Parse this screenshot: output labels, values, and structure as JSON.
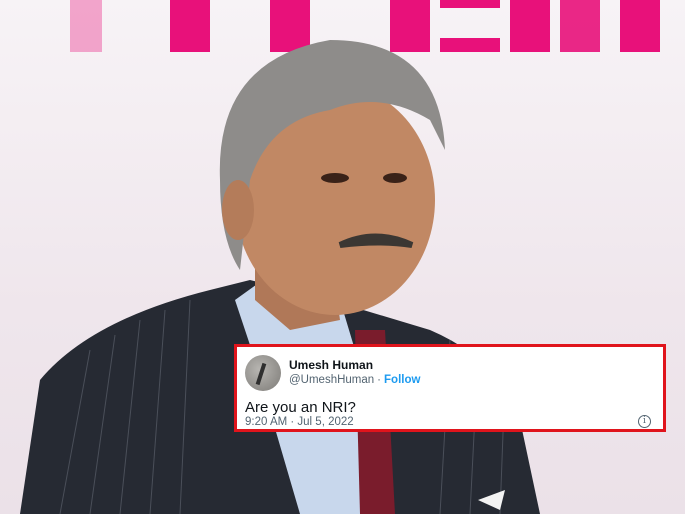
{
  "tweet": {
    "display_name": "Umesh Human",
    "handle": "@UmeshHuman",
    "separator": "·",
    "follow_label": "Follow",
    "text": "Are you an NRI?",
    "timestamp": "9:20 AM · Jul 5, 2022",
    "info_glyph": "i"
  },
  "colors": {
    "highlight_border": "#e0141c",
    "follow_link": "#1d9bf0",
    "background_letters": "#e8117a"
  },
  "icons": {
    "avatar": "profile-avatar",
    "info": "info-icon"
  }
}
